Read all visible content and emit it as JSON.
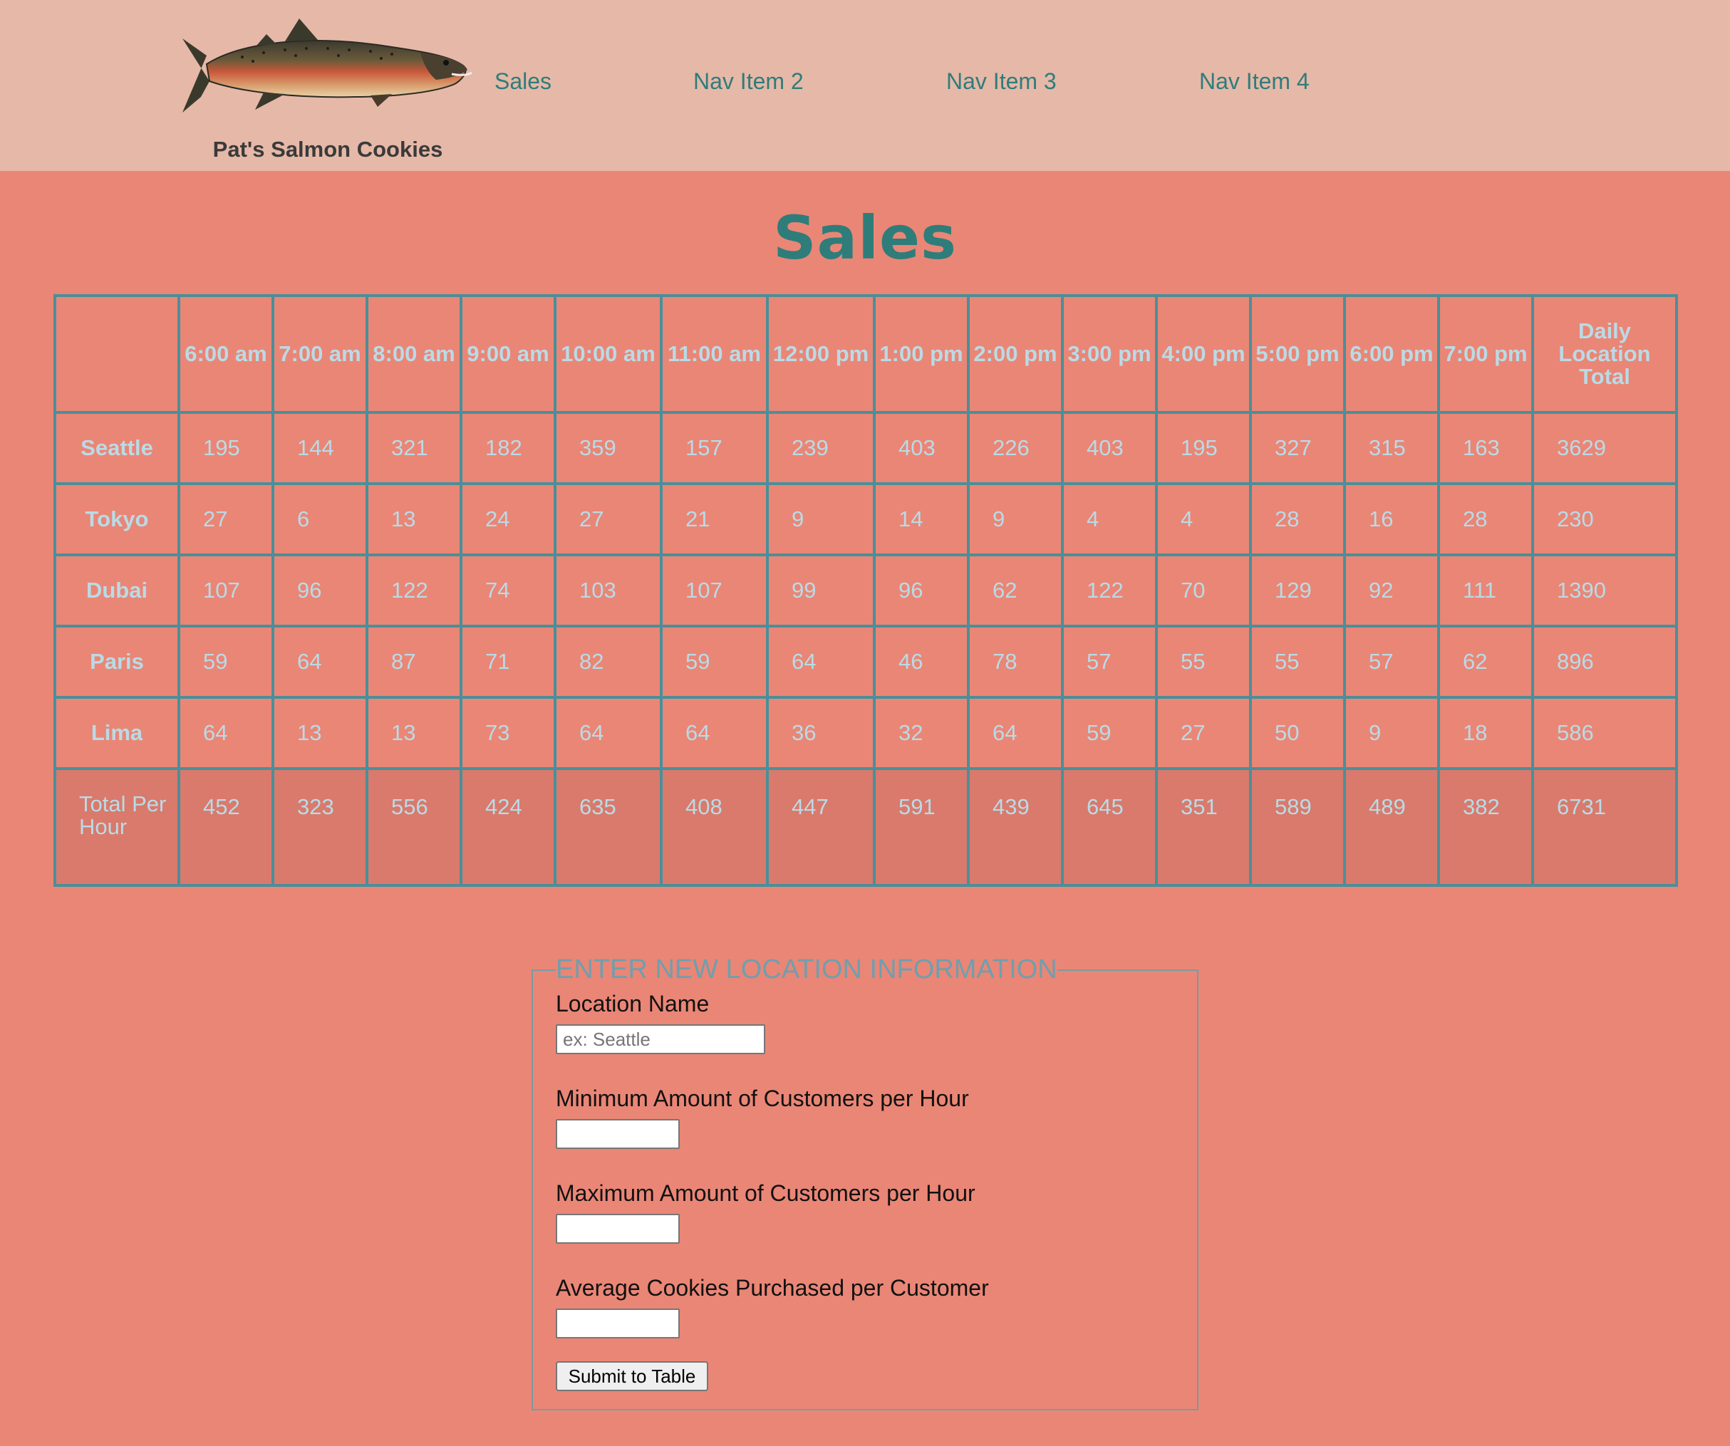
{
  "colors": {
    "header_bg": "#e6b8a8",
    "main_bg": "#ea8676",
    "accent": "#2e7d7a",
    "table_border": "#4a8f9a",
    "table_text": "#b9dbe6",
    "footer_bg": "#d97a6c",
    "legend": "#6f9fae"
  },
  "header": {
    "logo_icon": "salmon-fish-icon",
    "logo_text": "Pat's Salmon Cookies",
    "nav": [
      {
        "label": "Sales"
      },
      {
        "label": "Nav Item 2"
      },
      {
        "label": "Nav Item 3"
      },
      {
        "label": "Nav Item 4"
      }
    ]
  },
  "main": {
    "title": "Sales",
    "table": {
      "headers": [
        "6:00 am",
        "7:00 am",
        "8:00 am",
        "9:00 am",
        "10:00 am",
        "11:00 am",
        "12:00 pm",
        "1:00 pm",
        "2:00 pm",
        "3:00 pm",
        "4:00 pm",
        "5:00 pm",
        "6:00 pm",
        "7:00 pm",
        "Daily Location Total"
      ],
      "rows": [
        {
          "name": "Seattle",
          "values": [
            "195",
            "144",
            "321",
            "182",
            "359",
            "157",
            "239",
            "403",
            "226",
            "403",
            "195",
            "327",
            "315",
            "163",
            "3629"
          ]
        },
        {
          "name": "Tokyo",
          "values": [
            "27",
            "6",
            "13",
            "24",
            "27",
            "21",
            "9",
            "14",
            "9",
            "4",
            "4",
            "28",
            "16",
            "28",
            "230"
          ]
        },
        {
          "name": "Dubai",
          "values": [
            "107",
            "96",
            "122",
            "74",
            "103",
            "107",
            "99",
            "96",
            "62",
            "122",
            "70",
            "129",
            "92",
            "111",
            "1390"
          ]
        },
        {
          "name": "Paris",
          "values": [
            "59",
            "64",
            "87",
            "71",
            "82",
            "59",
            "64",
            "46",
            "78",
            "57",
            "55",
            "55",
            "57",
            "62",
            "896"
          ]
        },
        {
          "name": "Lima",
          "values": [
            "64",
            "13",
            "13",
            "73",
            "64",
            "64",
            "36",
            "32",
            "64",
            "59",
            "27",
            "50",
            "9",
            "18",
            "586"
          ]
        }
      ],
      "footer": {
        "label": "Total Per Hour",
        "values": [
          "452",
          "323",
          "556",
          "424",
          "635",
          "408",
          "447",
          "591",
          "439",
          "645",
          "351",
          "589",
          "489",
          "382",
          "6731"
        ]
      }
    }
  },
  "form": {
    "legend": "ENTER NEW LOCATION INFORMATION",
    "location_label": "Location Name",
    "location_placeholder": "ex: Seattle",
    "location_value": "",
    "min_label": "Minimum Amount of Customers per Hour",
    "min_value": "",
    "max_label": "Maximum Amount of Customers per Hour",
    "max_value": "",
    "avg_label": "Average Cookies Purchased per Customer",
    "avg_value": "",
    "submit_label": "Submit to Table"
  }
}
